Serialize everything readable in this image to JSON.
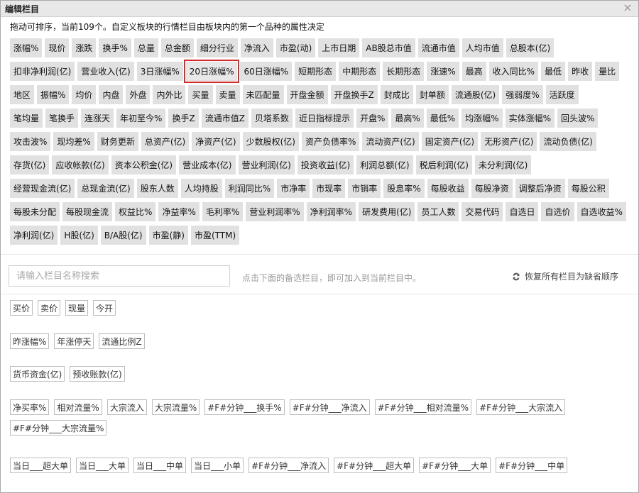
{
  "dialog": {
    "title": "编辑栏目",
    "close_icon": "×",
    "hint": "拖动可排序，当前109个。自定义板块的行情栏目由板块内的第一个品种的属性决定"
  },
  "active_rows": [
    [
      "涨幅%",
      "现价",
      "涨跌",
      "换手%",
      "总量",
      "总金额",
      "细分行业",
      "净流入",
      "市盈(动)",
      "上市日期",
      "AB股总市值",
      "流通市值",
      "人均市值",
      "总股本(亿)"
    ],
    [
      "扣非净利润(亿)",
      "营业收入(亿)",
      "3日涨幅%",
      "20日涨幅%",
      "60日涨幅%",
      "短期形态",
      "中期形态",
      "长期形态",
      "涨速%",
      "最高",
      "收入同比%",
      "最低",
      "昨收",
      "量比"
    ],
    [
      "地区",
      "振幅%",
      "均价",
      "内盘",
      "外盘",
      "内外比",
      "买量",
      "卖量",
      "未匹配量",
      "开盘金额",
      "开盘换手Z",
      "封成比",
      "封单额",
      "流通股(亿)",
      "强弱度%",
      "活跃度"
    ],
    [
      "笔均量",
      "笔换手",
      "连涨天",
      "年初至今%",
      "换手Z",
      "流通市值Z",
      "贝塔系数",
      "近日指标提示",
      "开盘%",
      "最高%",
      "最低%",
      "均涨幅%",
      "实体涨幅%",
      "回头波%"
    ],
    [
      "攻击波%",
      "现均差%",
      "财务更新",
      "总资产(亿)",
      "净资产(亿)",
      "少数股权(亿)",
      "资产负债率%",
      "流动资产(亿)",
      "固定资产(亿)",
      "无形资产(亿)",
      "流动负债(亿)"
    ],
    [
      "存货(亿)",
      "应收帐款(亿)",
      "资本公积金(亿)",
      "营业成本(亿)",
      "营业利润(亿)",
      "投资收益(亿)",
      "利润总额(亿)",
      "税后利润(亿)",
      "未分利润(亿)"
    ],
    [
      "经营现金流(亿)",
      "总现金流(亿)",
      "股东人数",
      "人均持股",
      "利润同比%",
      "市净率",
      "市现率",
      "市销率",
      "股息率%",
      "每股收益",
      "每股净资",
      "调整后净资",
      "每股公积"
    ],
    [
      "每股未分配",
      "每股现金流",
      "权益比%",
      "净益率%",
      "毛利率%",
      "营业利润率%",
      "净利润率%",
      "研发费用(亿)",
      "员工人数",
      "交易代码",
      "自选日",
      "自选价",
      "自选收益%"
    ],
    [
      "净利润(亿)",
      "H股(亿)",
      "B/A股(亿)",
      "市盈(静)",
      "市盈(TTM)"
    ]
  ],
  "selected_column": "20日涨幅%",
  "search": {
    "placeholder": "请输入栏目名称搜索",
    "hint": "点击下面的备选栏目，即可加入到当前栏目中。",
    "restore_label": "恢复所有栏目为缺省顺序"
  },
  "option_groups": [
    [
      "买价",
      "卖价",
      "现量",
      "今开"
    ],
    [
      "昨涨幅%",
      "年涨停天",
      "流通比例Z"
    ],
    [
      "货币资金(亿)",
      "预收账款(亿)"
    ],
    [
      "净买率%",
      "相对流量%",
      "大宗流入",
      "大宗流量%",
      "#F#分钟___换手%",
      "#F#分钟___净流入",
      "#F#分钟___相对流量%",
      "#F#分钟___大宗流入",
      "#F#分钟___大宗流量%"
    ],
    [
      "当日___超大单",
      "当日___大单",
      "当日___中单",
      "当日___小单",
      "#F#分钟___净流入",
      "#F#分钟___超大单",
      "#F#分钟___大单",
      "#F#分钟___中单"
    ]
  ],
  "colors": {
    "selected_border": "#d62b2b",
    "chip_bg": "#e1e1e1"
  }
}
